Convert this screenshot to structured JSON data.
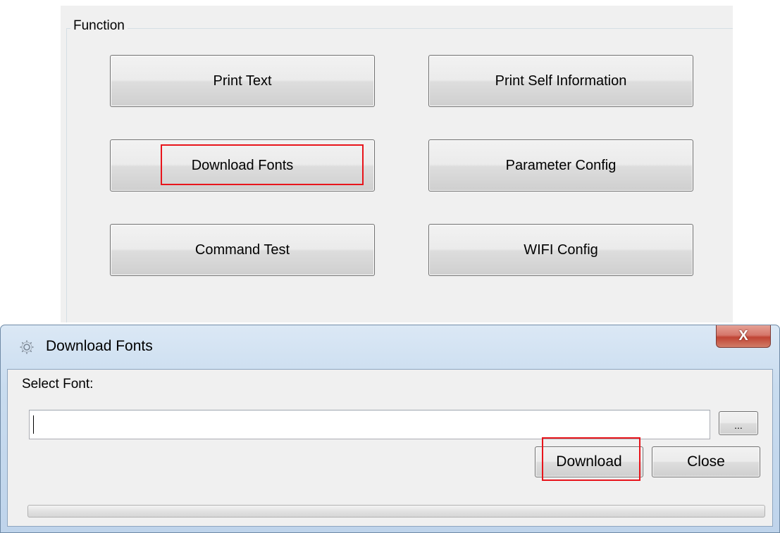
{
  "function_panel": {
    "group_label": "Function",
    "buttons": {
      "print_text": "Print Text",
      "print_self_information": "Print Self Information",
      "download_fonts": "Download Fonts",
      "parameter_config": "Parameter Config",
      "command_test": "Command Test",
      "wifi_config": "WIFI Config"
    },
    "highlighted_button": "download_fonts"
  },
  "dialog": {
    "title": "Download Fonts",
    "icon": "gear-icon",
    "close_glyph": "X",
    "select_font_label": "Select Font:",
    "font_path_value": "",
    "browse_label": "...",
    "download_label": "Download",
    "close_label": "Close",
    "progress": 0,
    "highlighted_button": "download"
  },
  "colors": {
    "highlight": "#e8141b",
    "panel_background": "#f0f0f0",
    "dialog_frame": "#c9dcef",
    "close_button": "#c04434"
  }
}
